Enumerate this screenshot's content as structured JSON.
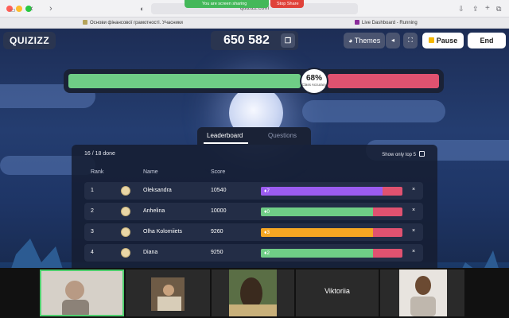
{
  "browser": {
    "url": "quizizz.com",
    "share_text": "You are screen sharing",
    "stop_share": "Stop Share",
    "tabs": [
      {
        "title": "Основи фінансової грамотності. Учасники",
        "color": "#b5a35a"
      },
      {
        "title": "Live Dashboard - Running",
        "color": "#8a2c9a"
      }
    ]
  },
  "header": {
    "logo": "QUIZIZZ",
    "game_code": "650 582",
    "themes_label": "Themes",
    "pause_label": "Pause",
    "end_label": "End",
    "icons": {
      "copy": "copy-icon",
      "themes": "palette-icon",
      "sound": "sound-icon",
      "fullscreen": "fullscreen-icon",
      "pause": "pause-icon"
    }
  },
  "accuracy": {
    "value": 68,
    "label_pct": "68%",
    "label": "Class Accuracy",
    "correct_color": "#6fcd86",
    "incorrect_color": "#e05270"
  },
  "tabs": {
    "leaderboard": "Leaderboard",
    "questions": "Questions"
  },
  "leaderboard": {
    "done": "16 / 18 done",
    "show_top": "Show only top 5",
    "columns": {
      "rank": "Rank",
      "name": "Name",
      "score": "Score"
    },
    "rows": [
      {
        "rank": "1",
        "name": "Oleksandra",
        "score": "10540",
        "streak": "7",
        "correct_frac": 0.86,
        "color": "#9b5cf0"
      },
      {
        "rank": "2",
        "name": "Anhelina",
        "score": "10000",
        "streak": "0",
        "correct_frac": 0.79,
        "color": "#6fcd86"
      },
      {
        "rank": "3",
        "name": "Olha Kolomiiets",
        "score": "9260",
        "streak": "3",
        "correct_frac": 0.79,
        "color": "#f5a623"
      },
      {
        "rank": "4",
        "name": "Diana",
        "score": "9250",
        "streak": "2",
        "correct_frac": 0.79,
        "color": "#6fcd86"
      }
    ],
    "remove_symbol": "×"
  },
  "videos": {
    "participant_name": "Viktoriia"
  }
}
